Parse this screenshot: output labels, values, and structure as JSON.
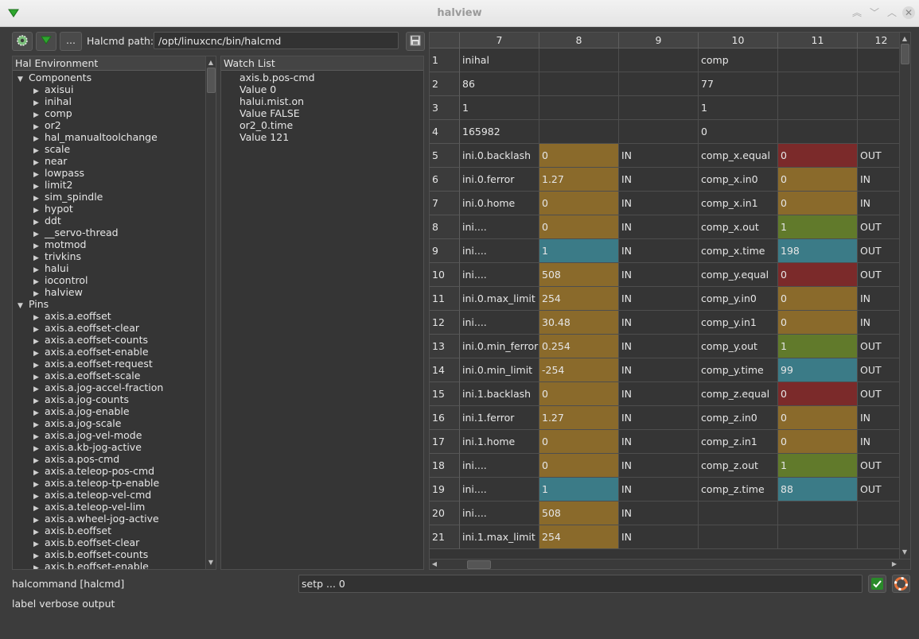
{
  "window": {
    "title": "halview"
  },
  "toolbar": {
    "more_label": "...",
    "path_label": "Halcmd path:",
    "path_value": "/opt/linuxcnc/bin/halcmd"
  },
  "tree": {
    "header": "Hal Environment",
    "components_label": "Components",
    "components": [
      "axisui",
      "inihal",
      "comp",
      "or2",
      "hal_manualtoolchange",
      "scale",
      "near",
      "lowpass",
      "limit2",
      "sim_spindle",
      "hypot",
      "ddt",
      "__servo-thread",
      "motmod",
      "trivkins",
      "halui",
      "iocontrol",
      "halview"
    ],
    "pins_label": "Pins",
    "pins": [
      "axis.a.eoffset",
      "axis.a.eoffset-clear",
      "axis.a.eoffset-counts",
      "axis.a.eoffset-enable",
      "axis.a.eoffset-request",
      "axis.a.eoffset-scale",
      "axis.a.jog-accel-fraction",
      "axis.a.jog-counts",
      "axis.a.jog-enable",
      "axis.a.jog-scale",
      "axis.a.jog-vel-mode",
      "axis.a.kb-jog-active",
      "axis.a.pos-cmd",
      "axis.a.teleop-pos-cmd",
      "axis.a.teleop-tp-enable",
      "axis.a.teleop-vel-cmd",
      "axis.a.teleop-vel-lim",
      "axis.a.wheel-jog-active",
      "axis.b.eoffset",
      "axis.b.eoffset-clear",
      "axis.b.eoffset-counts",
      "axis.b.eoffset-enable"
    ]
  },
  "watch": {
    "header": "Watch List",
    "items": [
      "axis.b.pos-cmd",
      "Value 0",
      "halui.mist.on",
      "Value FALSE",
      "or2_0.time",
      "Value 121"
    ]
  },
  "table": {
    "columns": [
      "7",
      "8",
      "9",
      "10",
      "11",
      "12"
    ],
    "rows": [
      {
        "n": "1",
        "c7": "inihal",
        "c8": "",
        "c8s": "",
        "c9": "",
        "c10": "comp",
        "c11": "",
        "c11s": "",
        "c12": ""
      },
      {
        "n": "2",
        "c7": "86",
        "c8": "",
        "c8s": "",
        "c9": "",
        "c10": "77",
        "c11": "",
        "c11s": "",
        "c12": ""
      },
      {
        "n": "3",
        "c7": "1",
        "c8": "",
        "c8s": "",
        "c9": "",
        "c10": "1",
        "c11": "",
        "c11s": "",
        "c12": ""
      },
      {
        "n": "4",
        "c7": "165982",
        "c8": "",
        "c8s": "",
        "c9": "",
        "c10": "0",
        "c11": "",
        "c11s": "",
        "c12": ""
      },
      {
        "n": "5",
        "c7": "ini.0.backlash",
        "c8": "0",
        "c8s": "float",
        "c9": "IN",
        "c10": "comp_x.equal",
        "c11": "0",
        "c11s": "false",
        "c12": "OUT"
      },
      {
        "n": "6",
        "c7": "ini.0.ferror",
        "c8": "1.27",
        "c8s": "float",
        "c9": "IN",
        "c10": "comp_x.in0",
        "c11": "0",
        "c11s": "float",
        "c12": "IN"
      },
      {
        "n": "7",
        "c7": "ini.0.home",
        "c8": "0",
        "c8s": "float",
        "c9": "IN",
        "c10": "comp_x.in1",
        "c11": "0",
        "c11s": "float",
        "c12": "IN"
      },
      {
        "n": "8",
        "c7": "ini....",
        "c8": "0",
        "c8s": "float",
        "c9": "IN",
        "c10": "comp_x.out",
        "c11": "1",
        "c11s": "true",
        "c12": "OUT"
      },
      {
        "n": "9",
        "c7": "ini....",
        "c8": "1",
        "c8s": "s32",
        "c9": "IN",
        "c10": "comp_x.time",
        "c11": "198",
        "c11s": "s32",
        "c12": "OUT"
      },
      {
        "n": "10",
        "c7": "ini....",
        "c8": "508",
        "c8s": "float",
        "c9": "IN",
        "c10": "comp_y.equal",
        "c11": "0",
        "c11s": "false",
        "c12": "OUT"
      },
      {
        "n": "11",
        "c7": "ini.0.max_limit",
        "c8": "254",
        "c8s": "float",
        "c9": "IN",
        "c10": "comp_y.in0",
        "c11": "0",
        "c11s": "float",
        "c12": "IN"
      },
      {
        "n": "12",
        "c7": "ini....",
        "c8": "30.48",
        "c8s": "float",
        "c9": "IN",
        "c10": "comp_y.in1",
        "c11": "0",
        "c11s": "float",
        "c12": "IN"
      },
      {
        "n": "13",
        "c7": "ini.0.min_ferror",
        "c8": "0.254",
        "c8s": "float",
        "c9": "IN",
        "c10": "comp_y.out",
        "c11": "1",
        "c11s": "true",
        "c12": "OUT"
      },
      {
        "n": "14",
        "c7": "ini.0.min_limit",
        "c8": "-254",
        "c8s": "float",
        "c9": "IN",
        "c10": "comp_y.time",
        "c11": "99",
        "c11s": "s32",
        "c12": "OUT"
      },
      {
        "n": "15",
        "c7": "ini.1.backlash",
        "c8": "0",
        "c8s": "float",
        "c9": "IN",
        "c10": "comp_z.equal",
        "c11": "0",
        "c11s": "false",
        "c12": "OUT"
      },
      {
        "n": "16",
        "c7": "ini.1.ferror",
        "c8": "1.27",
        "c8s": "float",
        "c9": "IN",
        "c10": "comp_z.in0",
        "c11": "0",
        "c11s": "float",
        "c12": "IN"
      },
      {
        "n": "17",
        "c7": "ini.1.home",
        "c8": "0",
        "c8s": "float",
        "c9": "IN",
        "c10": "comp_z.in1",
        "c11": "0",
        "c11s": "float",
        "c12": "IN"
      },
      {
        "n": "18",
        "c7": "ini....",
        "c8": "0",
        "c8s": "float",
        "c9": "IN",
        "c10": "comp_z.out",
        "c11": "1",
        "c11s": "true",
        "c12": "OUT"
      },
      {
        "n": "19",
        "c7": "ini....",
        "c8": "1",
        "c8s": "s32",
        "c9": "IN",
        "c10": "comp_z.time",
        "c11": "88",
        "c11s": "s32",
        "c12": "OUT"
      },
      {
        "n": "20",
        "c7": "ini....",
        "c8": "508",
        "c8s": "float",
        "c9": "IN",
        "c10": "",
        "c11": "",
        "c11s": "",
        "c12": ""
      },
      {
        "n": "21",
        "c7": "ini.1.max_limit",
        "c8": "254",
        "c8s": "float",
        "c9": "IN",
        "c10": "",
        "c11": "",
        "c11s": "",
        "c12": ""
      }
    ]
  },
  "command": {
    "label": "halcommand [halcmd]",
    "value": "setp ... 0"
  },
  "status": {
    "verbose_label": "label verbose output"
  },
  "colors": {
    "float_bg": "#8a6a2b",
    "s32_bg": "#3b7b87",
    "false_bg": "#7b2a2a",
    "true_bg": "#617a2b",
    "accent": "#2a8a2a"
  }
}
